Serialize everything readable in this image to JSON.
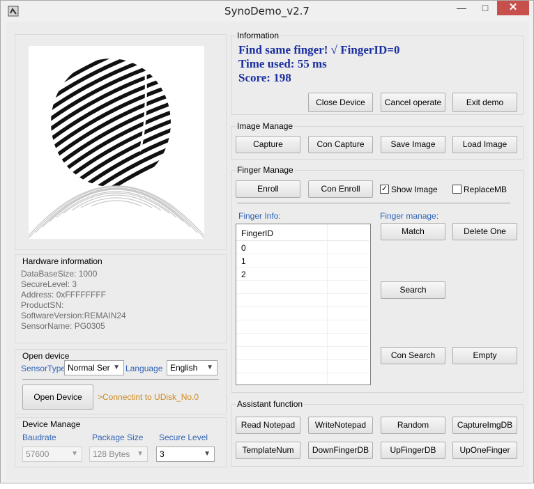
{
  "window": {
    "title": "SynoDemo_v2.7",
    "minimize": "—",
    "maximize": "□",
    "close": "✕"
  },
  "information": {
    "group_label": "Information",
    "line1": "Find same finger! √  FingerID=0",
    "line2": "Time used: 55 ms",
    "line3": "Score: 198",
    "buttons": {
      "close_device": "Close Device",
      "cancel_operate": "Cancel operate",
      "exit_demo": "Exit demo"
    }
  },
  "image_manage": {
    "group_label": "Image Manage",
    "buttons": {
      "capture": "Capture",
      "con_capture": "Con Capture",
      "save_image": "Save Image",
      "load_image": "Load Image"
    }
  },
  "finger_manage": {
    "group_label": "Finger Manage",
    "enroll": "Enroll",
    "con_enroll": "Con Enroll",
    "show_image": {
      "label": "Show Image",
      "checked": true
    },
    "replace_mb": {
      "label": "ReplaceMB",
      "checked": false
    },
    "finger_info_label": "Finger Info:",
    "finger_manage_label": "Finger manage:",
    "list_header": "FingerID",
    "ids": [
      "0",
      "1",
      "2"
    ],
    "match": "Match",
    "delete_one": "Delete One",
    "search": "Search",
    "con_search": "Con Search",
    "empty": "Empty"
  },
  "hardware": {
    "group_label": "Hardware information",
    "lines": [
      "DataBaseSize: 1000",
      "SecureLevel:  3",
      "Address:    0xFFFFFFFF",
      "ProductSN:",
      "SoftwareVersion:REMAIN24",
      "SensorName:  PG0305"
    ]
  },
  "open_device": {
    "group_label": "Open device",
    "sensor_type_label": "SensorType",
    "sensor_type_value": "Normal Ser",
    "language_label": "Language",
    "language_value": "English",
    "open_button": "Open Device",
    "status": ">Connectint to UDisk_No.0"
  },
  "device_manage": {
    "group_label": "Device Manage",
    "baudrate_label": "Baudrate",
    "baudrate_value": "57600",
    "package_label": "Package Size",
    "package_value": "128 Bytes",
    "secure_label": "Secure Level",
    "secure_value": "3"
  },
  "assistant": {
    "group_label": "Assistant function",
    "row1": [
      "Read Notepad",
      "WriteNotepad",
      "Random",
      "CaptureImgDB"
    ],
    "row2": [
      "TemplateNum",
      "DownFingerDB",
      "UpFingerDB",
      "UpOneFinger"
    ]
  },
  "colors": {
    "info_text": "#1a2fa0",
    "blue_label": "#2f63b5",
    "status_text": "#d08a1e",
    "close_button": "#c7504d"
  },
  "fingerprint": {
    "description": "fingerprint-image"
  }
}
